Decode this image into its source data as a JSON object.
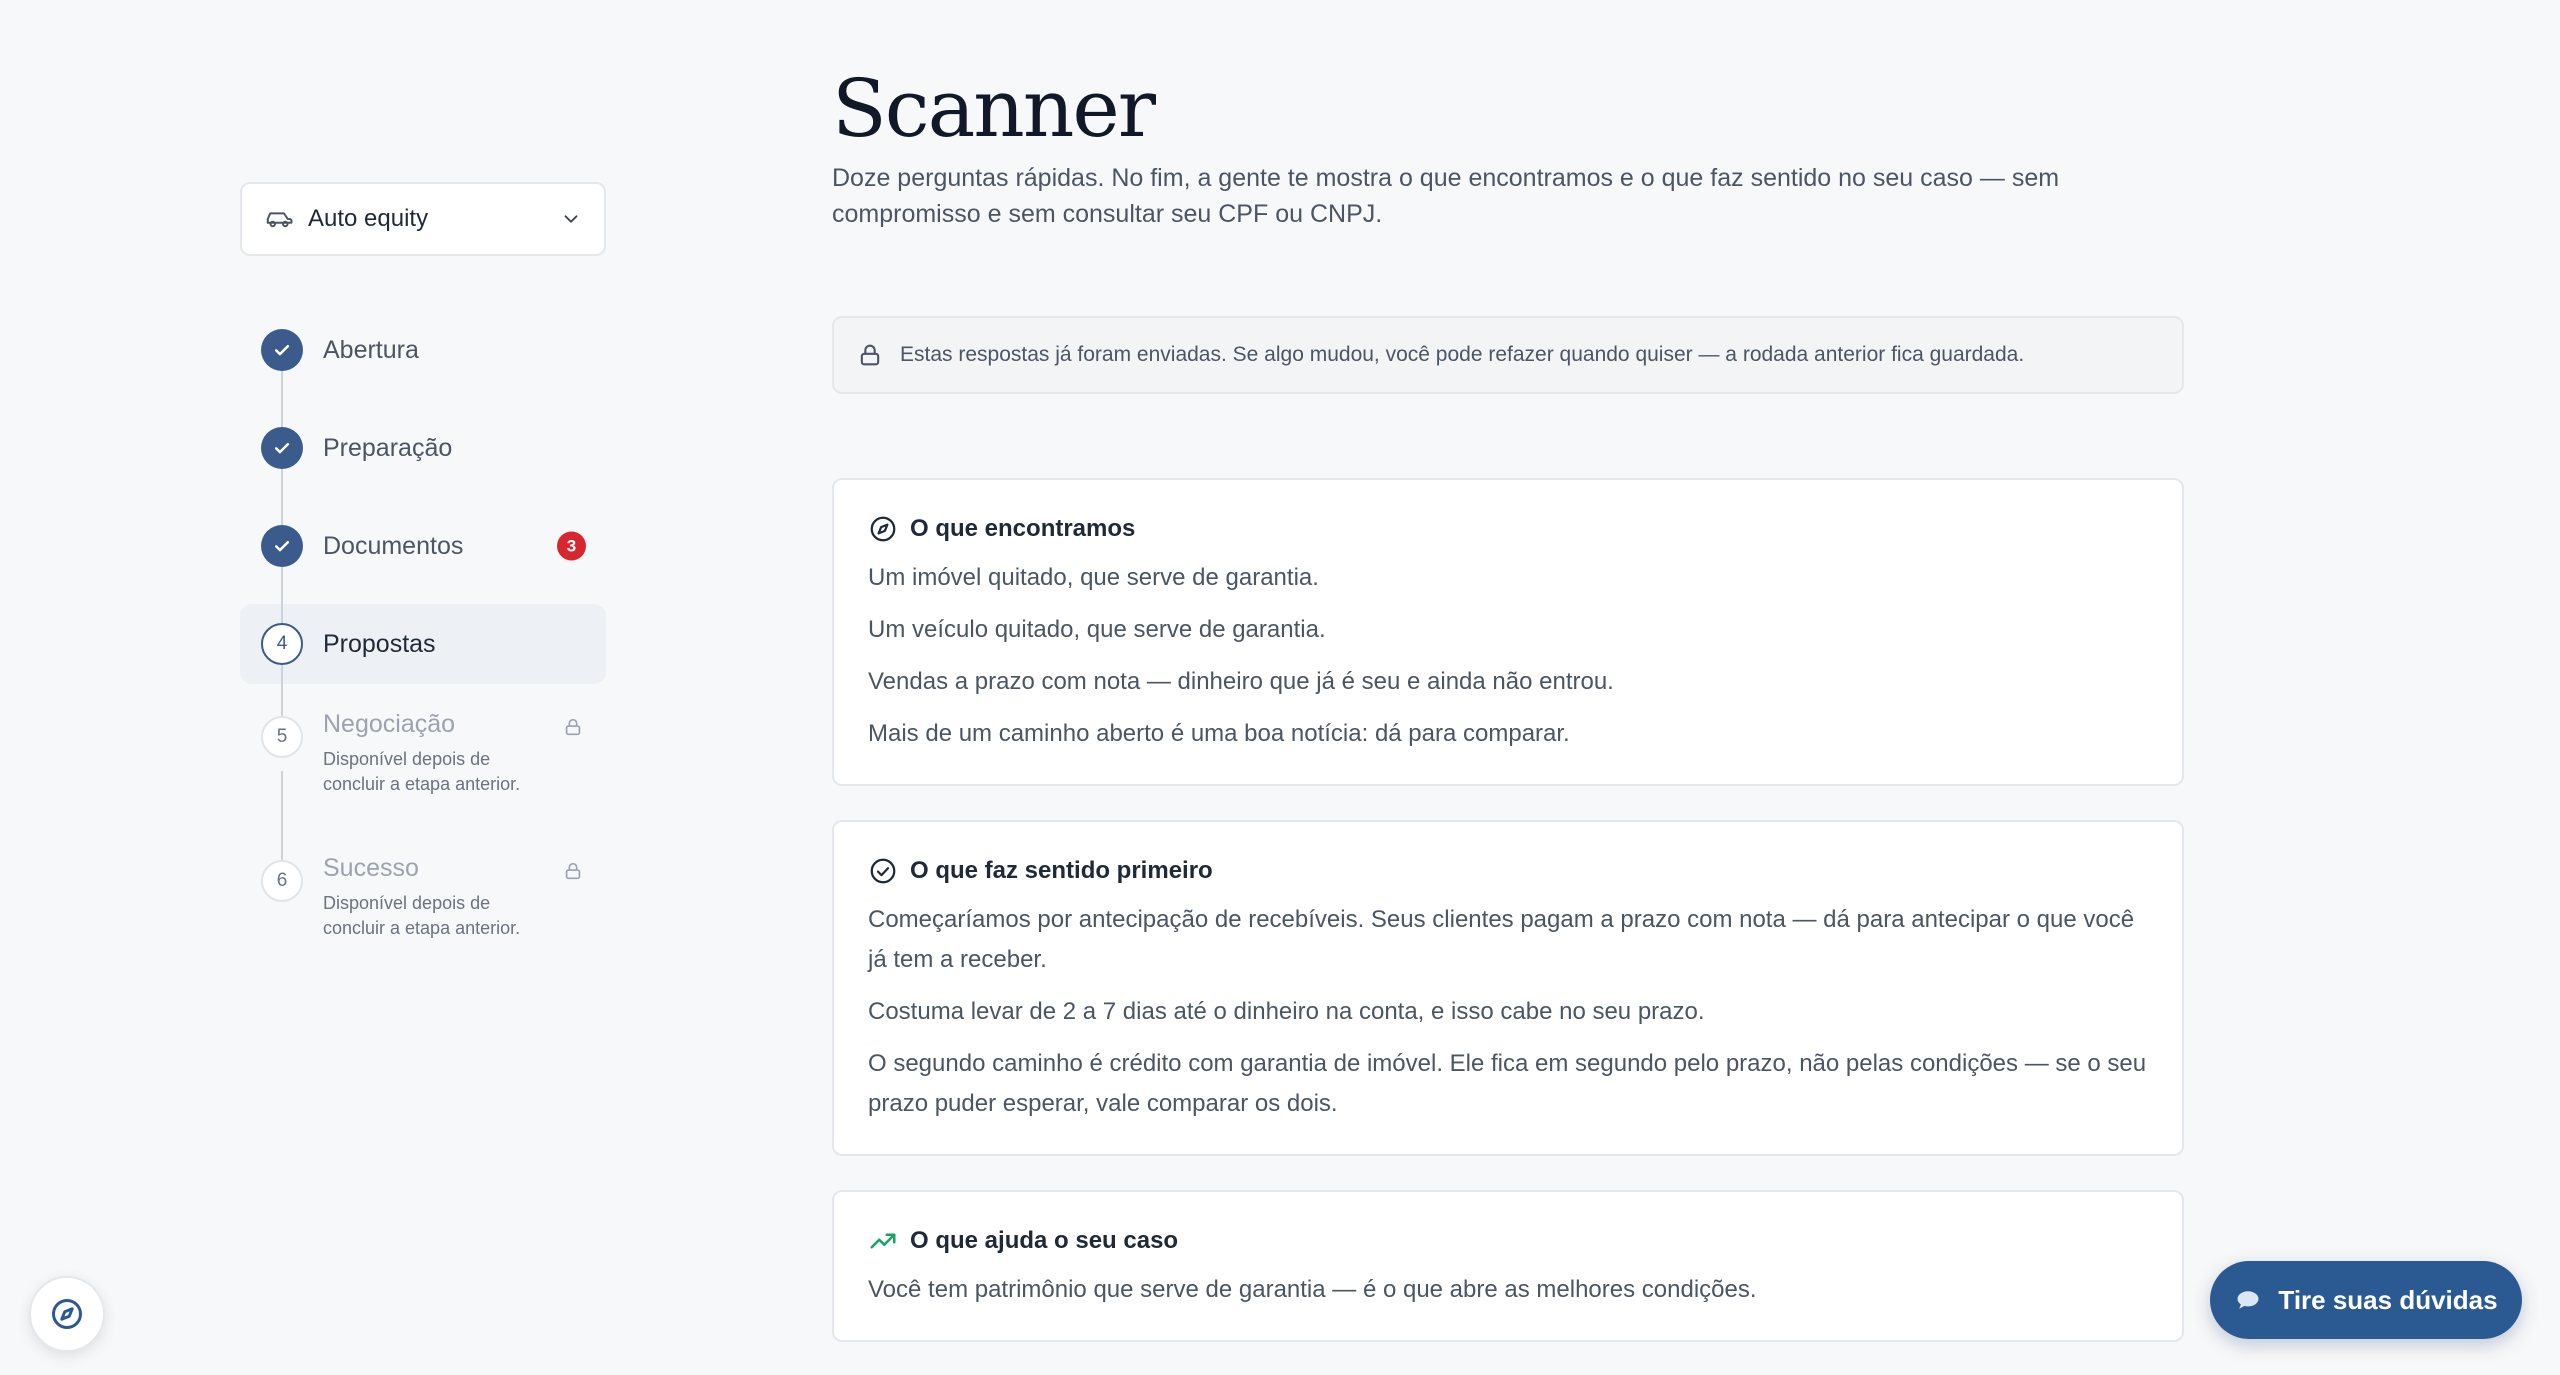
{
  "sidebar": {
    "product_select": {
      "value": "Auto equity",
      "icon": "car-icon"
    },
    "steps": [
      {
        "number": "1",
        "label": "Abertura",
        "status": "done"
      },
      {
        "number": "2",
        "label": "Preparação",
        "status": "done"
      },
      {
        "number": "3",
        "label": "Documentos",
        "status": "done",
        "badge": "3"
      },
      {
        "number": "4",
        "label": "Propostas",
        "status": "current"
      },
      {
        "number": "5",
        "label": "Negociação",
        "status": "locked",
        "sub": "Disponível depois de concluir a etapa anterior."
      },
      {
        "number": "6",
        "label": "Sucesso",
        "status": "locked",
        "sub": "Disponível depois de concluir a etapa anterior."
      }
    ]
  },
  "main": {
    "title": "Scanner",
    "subtitle": "Doze perguntas rápidas. No fim, a gente te mostra o que encontramos e o que faz sentido no seu caso — sem compromisso e sem consultar seu CPF ou CNPJ.",
    "notice": "Estas respostas já foram enviadas. Se algo mudou, você pode refazer quando quiser — a rodada anterior fica guardada.",
    "cards": [
      {
        "icon": "compass-icon",
        "title": "O que encontramos",
        "lines": [
          "Um imóvel quitado, que serve de garantia.",
          "Um veículo quitado, que serve de garantia.",
          "Vendas a prazo com nota — dinheiro que já é seu e ainda não entrou.",
          "Mais de um caminho aberto é uma boa notícia: dá para comparar."
        ]
      },
      {
        "icon": "check-circle-icon",
        "title": "O que faz sentido primeiro",
        "lines": [
          "Começaríamos por antecipação de recebíveis. Seus clientes pagam a prazo com nota — dá para antecipar o que você já tem a receber.",
          "Costuma levar de 2 a 7 dias até o dinheiro na conta, e isso cabe no seu prazo.",
          "O segundo caminho é crédito com garantia de imóvel. Ele fica em segundo pelo prazo, não pelas condições — se o seu prazo puder esperar, vale comparar os dois."
        ]
      },
      {
        "icon": "trending-up-icon",
        "title": "O que ajuda o seu caso",
        "lines": [
          "Você tem patrimônio que serve de garantia — é o que abre as melhores condições."
        ]
      }
    ]
  },
  "floating": {
    "help_icon": "compass-icon",
    "chat_label": "Tire suas dúvidas",
    "chat_icon": "chat-bubble-icon"
  },
  "colors": {
    "primary": "#2b5a93",
    "step_done": "#3a5b8c",
    "badge": "#d8262f",
    "trend_green": "#16a36a"
  }
}
